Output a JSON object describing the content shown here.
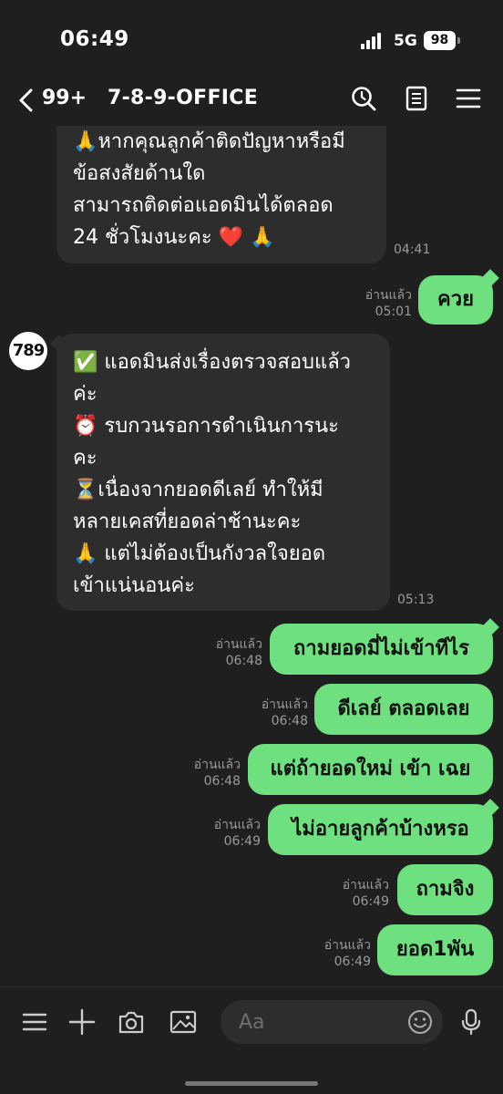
{
  "status_bar": {
    "time": "06:49",
    "network": "5G",
    "battery": "98"
  },
  "header": {
    "unread_count": "99+",
    "title": "7-8-9-OFFICE"
  },
  "avatar": {
    "label": "789"
  },
  "messages": {
    "m1": {
      "lines": [
        "🙏หากคุณลูกค้าติดปัญหาหรือมี",
        "ข้อสงสัยด้านใด",
        "สามารถติดต่อแอดมินได้ตลอด",
        "24 ชั่วโมงนะคะ ❤️ 🙏"
      ],
      "time": "04:41"
    },
    "m2": {
      "text": "ควย",
      "read": "อ่านแล้ว",
      "time": "05:01"
    },
    "m3": {
      "lines": [
        "✅ แอดมินส่งเรื่องตรวจสอบแล้ว",
        "ค่ะ",
        "⏰ รบกวนรอการดำเนินการนะ",
        "คะ",
        "⏳เนื่องจากยอดดีเลย์ ทำให้มี",
        "หลายเคสที่ยอดล่าช้านะคะ",
        "🙏 แต่ไม่ต้องเป็นกังวลใจยอด",
        "เข้าแน่นอนค่ะ"
      ],
      "time": "05:13"
    },
    "m4": {
      "text": "ถามยอดมี่ไม่เข้าทีไร",
      "read": "อ่านแล้ว",
      "time": "06:48"
    },
    "m5": {
      "text": "ดีเลย์ ตลอดเลย",
      "read": "อ่านแล้ว",
      "time": "06:48"
    },
    "m6": {
      "text": "แต่ถ้ายอดใหม่ เข้า เฉย",
      "read": "อ่านแล้ว",
      "time": "06:48"
    },
    "m7": {
      "text": "ไม่อายลูกค้าบ้างหรอ",
      "read": "อ่านแล้ว",
      "time": "06:49"
    },
    "m8": {
      "text": "ถามจิง",
      "read": "อ่านแล้ว",
      "time": "06:49"
    },
    "m9": {
      "text": "ยอด1พัน",
      "read": "อ่านแล้ว",
      "time": "06:49"
    }
  },
  "input": {
    "placeholder": "Aa"
  },
  "icons": {
    "back": "chevron-left-icon",
    "search": "search-icon",
    "notes": "document-icon",
    "menu": "hamburger-icon",
    "more": "menu-icon",
    "add": "plus-icon",
    "camera": "camera-icon",
    "gallery": "image-icon",
    "emoji": "smiley-icon",
    "mic": "microphone-icon"
  },
  "colors": {
    "background": "#1f1f1f",
    "incoming_bubble": "#2d2d2d",
    "outgoing_bubble": "#6ee07f",
    "meta_text": "#9a9a9a"
  }
}
